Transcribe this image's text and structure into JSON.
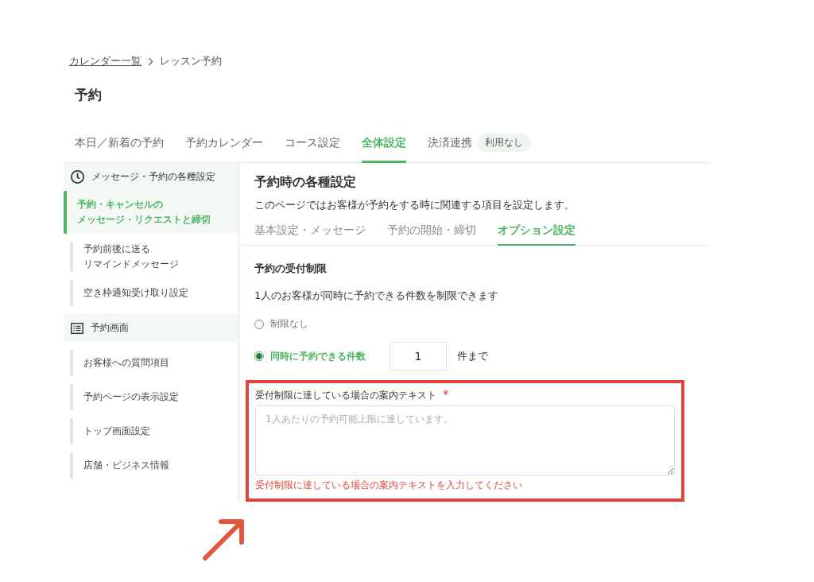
{
  "breadcrumb": [
    {
      "label": "カレンダー一覧",
      "kind": "link"
    },
    {
      "label": "レッスン予約",
      "kind": "current"
    }
  ],
  "page_title": "予約",
  "tabs": [
    {
      "label": "本日／新着の予約",
      "selected": false
    },
    {
      "label": "予約カレンダー",
      "selected": false
    },
    {
      "label": "コース設定",
      "selected": false
    },
    {
      "label": "全体設定",
      "selected": true
    },
    {
      "label": "決済連携",
      "selected": false,
      "badge": "利用なし"
    }
  ],
  "sidebar": {
    "items": [
      {
        "kind": "header",
        "label": "メッセージ・予約の各種設定"
      },
      {
        "kind": "item",
        "lines": [
          "予約・キャンセルの",
          "メッセージ・リクエストと締切"
        ],
        "selected": true
      },
      {
        "kind": "item",
        "lines": [
          "予約前後に送る",
          "リマインドメッセージ"
        ],
        "selected": false
      },
      {
        "kind": "item",
        "label": "空き枠通知受け取り設定",
        "selected": false
      },
      {
        "kind": "header",
        "label": "予約画面"
      },
      {
        "kind": "item",
        "label": "お客様への質問項目",
        "selected": false
      },
      {
        "kind": "item",
        "label": "予約ページの表示設定",
        "selected": false
      },
      {
        "kind": "item",
        "label": "トップ画面設定",
        "selected": false
      },
      {
        "kind": "item",
        "label": "店舗・ビジネス情報",
        "selected": false
      }
    ]
  },
  "content": {
    "title": "予約時の各種設定",
    "description": "このページではお客様が予約をする時に関連する項目を設定します。",
    "subtabs": [
      {
        "label": "基本設定・メッセージ",
        "selected": false
      },
      {
        "label": "予約の開始・締切",
        "selected": false
      },
      {
        "label": "オプション設定",
        "selected": true
      }
    ],
    "section_title": "予約の受付制限",
    "section_description": "1人のお客様が同時に予約できる件数を制限できます",
    "options": [
      {
        "label": "制限なし",
        "selected": false
      },
      {
        "label": "同時に予約できる件数",
        "selected": true,
        "value": "1",
        "suffix": "件まで"
      }
    ],
    "guide_field": {
      "label": "受付制限に達している場合の案内テキスト",
      "required_mark": "*",
      "placeholder": "1人あたりの予約可能上限に達しています。",
      "error": "受付制限に達している場合の案内テキストを入力してください",
      "highlighted": true
    }
  }
}
